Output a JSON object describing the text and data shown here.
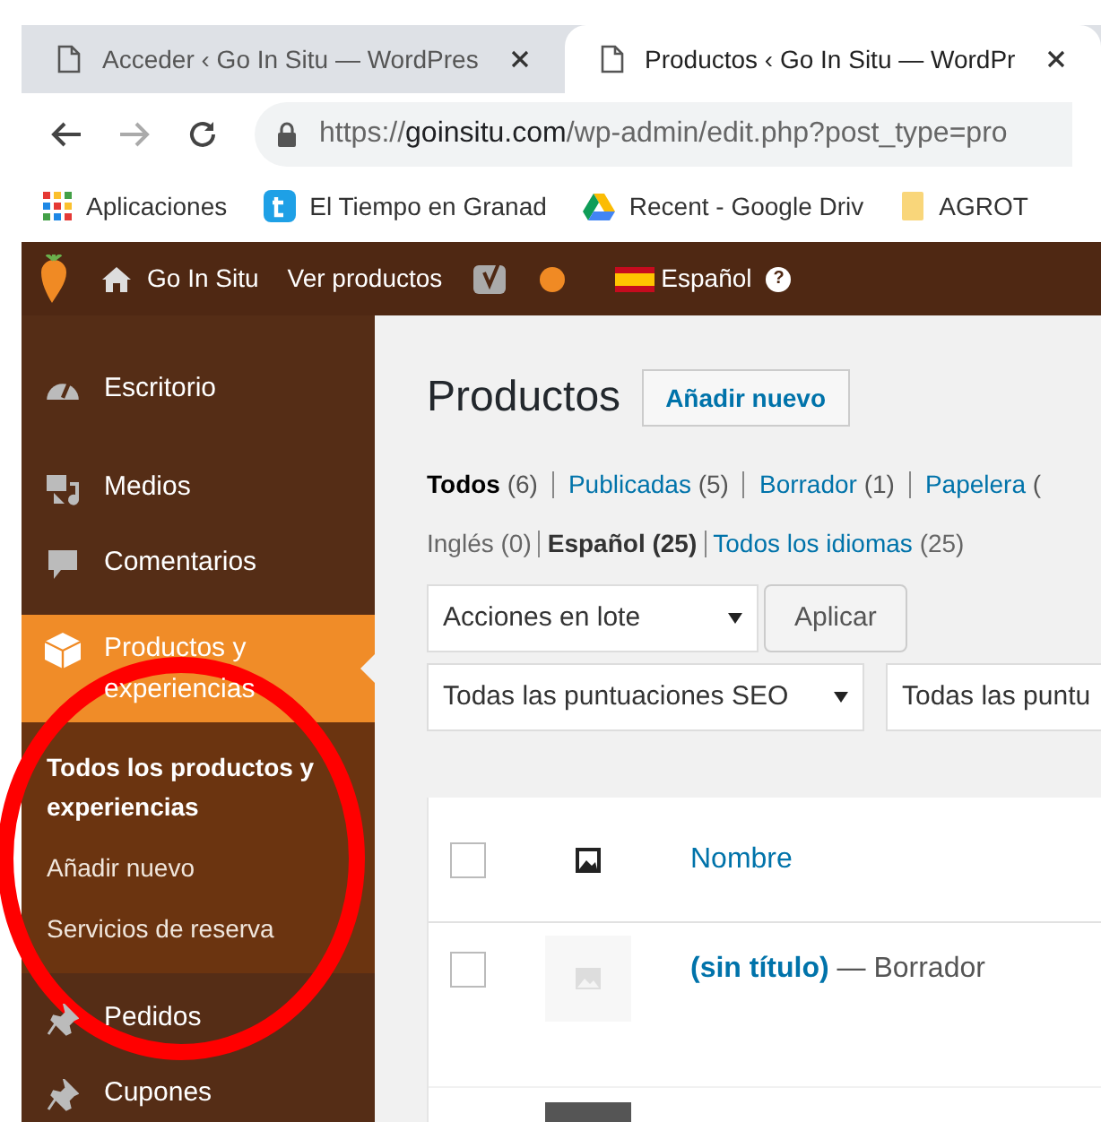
{
  "browser": {
    "tabs": [
      {
        "title": "Acceder ‹ Go In Situ — WordPres",
        "selected": false
      },
      {
        "title": "Productos ‹ Go In Situ — WordPr",
        "selected": true
      }
    ],
    "url": {
      "scheme": "https://",
      "host": "goinsitu.com",
      "path": "/wp-admin/edit.php?post_type=pro"
    },
    "bookmarks": [
      {
        "label": "Aplicaciones",
        "kind": "apps"
      },
      {
        "label": "El Tiempo en Granad",
        "kind": "weather"
      },
      {
        "label": "Recent - Google Driv",
        "kind": "drive"
      },
      {
        "label": "AGROT",
        "kind": "folder"
      }
    ]
  },
  "admin_bar": {
    "site": "Go In Situ",
    "view": "Ver productos",
    "language": "Español",
    "help": "?"
  },
  "sidebar": {
    "items": [
      {
        "label": "Escritorio",
        "kind": "dashboard",
        "selected": false
      },
      {
        "label": "Medios",
        "kind": "media",
        "selected": false
      },
      {
        "label": "Comentarios",
        "kind": "comments",
        "selected": false
      },
      {
        "label": "Productos y experiencias",
        "kind": "box",
        "selected": true,
        "children": [
          {
            "label": "Todos los productos y experiencias",
            "selected": true
          },
          {
            "label": "Añadir nuevo",
            "selected": false
          },
          {
            "label": "Servicios de reserva",
            "selected": false
          }
        ]
      },
      {
        "label": "Pedidos",
        "kind": "pin",
        "selected": false
      },
      {
        "label": "Cupones",
        "kind": "pin",
        "selected": false
      }
    ]
  },
  "page": {
    "title": "Productos",
    "add_button": "Añadir nuevo",
    "status_filters": [
      {
        "label": "Todos",
        "count": "(6)",
        "selected": true
      },
      {
        "label": "Publicadas",
        "count": "(5)",
        "selected": false
      },
      {
        "label": "Borrador",
        "count": "(1)",
        "selected": false
      },
      {
        "label": "Papelera",
        "count": "(",
        "selected": false
      }
    ],
    "language_filters": [
      {
        "label": "Inglés",
        "count": "(0)",
        "selected": false,
        "link": false
      },
      {
        "label": "Español",
        "count": "(25)",
        "selected": true,
        "link": false
      },
      {
        "label": "Todos los idiomas",
        "count": "(25)",
        "selected": false,
        "link": true
      }
    ],
    "bulk_action": "Acciones en lote",
    "apply_button": "Aplicar",
    "seo_filter": "Todas las puntuaciones SEO",
    "filter_2": "Todas las puntu",
    "table": {
      "select_all_checked": false,
      "columns": [
        "Nombre"
      ],
      "rows": [
        {
          "title": "(sin título)",
          "status": "— Borrador",
          "checked": false
        }
      ]
    }
  }
}
